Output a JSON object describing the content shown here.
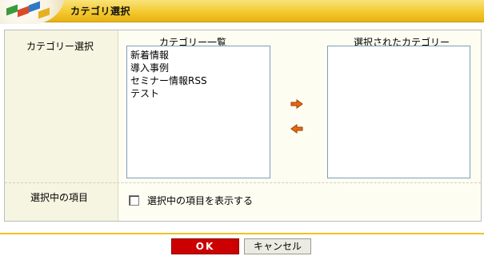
{
  "header": {
    "title": "カテゴリ選択"
  },
  "form": {
    "category_label": "カテゴリー選択",
    "list_header_left": "カテゴリー一覧",
    "list_header_right": "選択されたカテゴリー",
    "categories": [
      "新着情報",
      "導入事例",
      "セミナー情報RSS",
      "テスト"
    ],
    "selected_categories": [],
    "selected_items_label": "選択中の項目",
    "show_selected_checkbox_label": "選択中の項目を表示する",
    "show_selected_checked": false
  },
  "footer": {
    "ok_label": "OK",
    "cancel_label": "キャンセル"
  },
  "colors": {
    "header": "#f4c92f",
    "ok_button": "#cc0000",
    "arrow": "#e86a10"
  },
  "icons": {
    "move_right": "arrow-right-icon",
    "move_left": "arrow-left-icon"
  }
}
